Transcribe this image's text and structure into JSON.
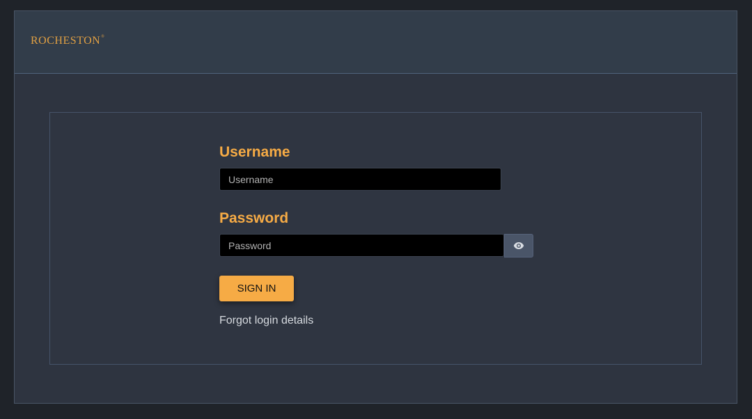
{
  "brand": {
    "name": "ROCHESTON",
    "trademark": "®",
    "color": "#e1a043"
  },
  "form": {
    "username_label": "Username",
    "username_placeholder": "Username",
    "username_value": "",
    "password_label": "Password",
    "password_placeholder": "Password",
    "password_value": "",
    "toggle_icon": "eye-icon",
    "signin_label": "SIGN IN",
    "forgot_label": "Forgot login details"
  },
  "colors": {
    "accent": "#f6ab45",
    "background": "#2e3440",
    "input_bg": "#000000"
  }
}
